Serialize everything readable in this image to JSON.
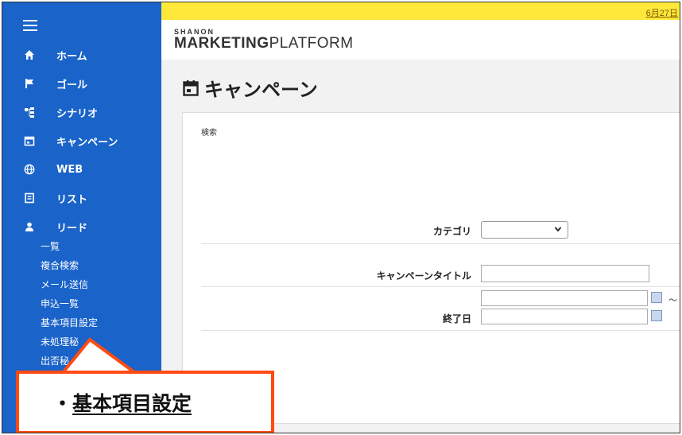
{
  "topbar": {
    "date": "6月27日"
  },
  "brand": {
    "small": "SHANON",
    "main_bold": "MARKETING",
    "main_light": "PLATFORM"
  },
  "sidebar": {
    "items": [
      {
        "label": "ホーム",
        "icon": "home-icon"
      },
      {
        "label": "ゴール",
        "icon": "flag-icon"
      },
      {
        "label": "シナリオ",
        "icon": "scenario-icon"
      },
      {
        "label": "キャンペーン",
        "icon": "calendar-icon"
      },
      {
        "label": "WEB",
        "icon": "globe-icon"
      },
      {
        "label": "リスト",
        "icon": "list-icon"
      },
      {
        "label": "リード",
        "icon": "person-icon"
      }
    ],
    "sub_items": [
      "一覧",
      "複合検索",
      "メール送信",
      "申込一覧",
      "基本項目設定",
      "未処理秘",
      "出否秘"
    ]
  },
  "page": {
    "title": "キャンペーン",
    "section_label": "検索",
    "fields": {
      "category_label": "カテゴリ",
      "category_value": "",
      "campaign_title_label": "キャンペーンタイトル",
      "campaign_title_value": "",
      "start_date_value": "",
      "range_separator": "～",
      "end_date_label": "終了日",
      "end_date_value": ""
    }
  },
  "callout": {
    "bullet": "・",
    "text": "基本項目設定"
  },
  "colors": {
    "sidebar": "#1a63c9",
    "topbar": "#ffe83a",
    "callout_border": "#ff4a12"
  }
}
